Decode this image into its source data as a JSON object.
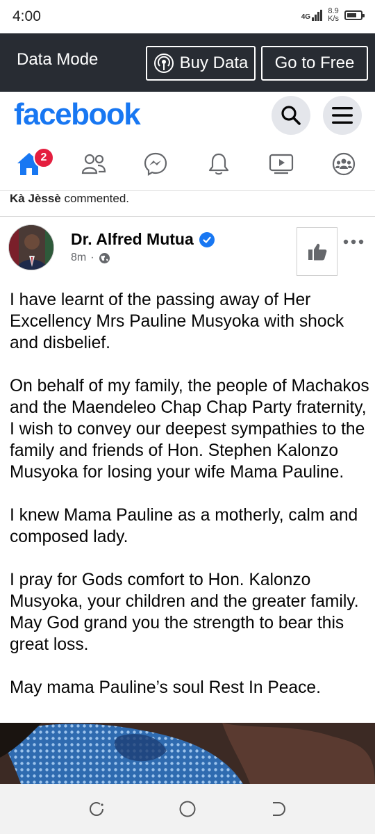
{
  "status_bar": {
    "time": "4:00",
    "network_type": "4G",
    "speed_value": "8.9",
    "speed_unit": "K/s"
  },
  "data_mode": {
    "label": "Data Mode",
    "buy_data_label": "Buy Data",
    "go_free_label": "Go to Free"
  },
  "header": {
    "logo_text": "facebook",
    "brand_color": "#1877f2"
  },
  "nav": {
    "home_badge": "2",
    "icons": [
      "home-icon",
      "friends-icon",
      "messenger-icon",
      "notifications-icon",
      "watch-icon",
      "groups-icon"
    ]
  },
  "activity": {
    "actor": "Kà Jèssè",
    "action": "commented."
  },
  "post": {
    "author": "Dr. Alfred Mutua",
    "time": "8m",
    "separator": "·",
    "paragraphs": [
      "I have learnt of the passing away of Her Excellency Mrs Pauline Musyoka with shock and disbelief.",
      "On behalf of my family, the people of Machakos and the Maendeleo Chap Chap Party fraternity, I wish to convey our deepest sympathies to the family and friends of Hon. Stephen Kalonzo Musyoka for losing your wife Mama Pauline.",
      "I knew Mama Pauline as a motherly, calm and composed  lady.",
      "I pray for Gods comfort to Hon. Kalonzo Musyoka, your children and the greater family. May God grand you the strength to bear this great loss.",
      "May mama Pauline’s soul Rest In Peace."
    ]
  }
}
